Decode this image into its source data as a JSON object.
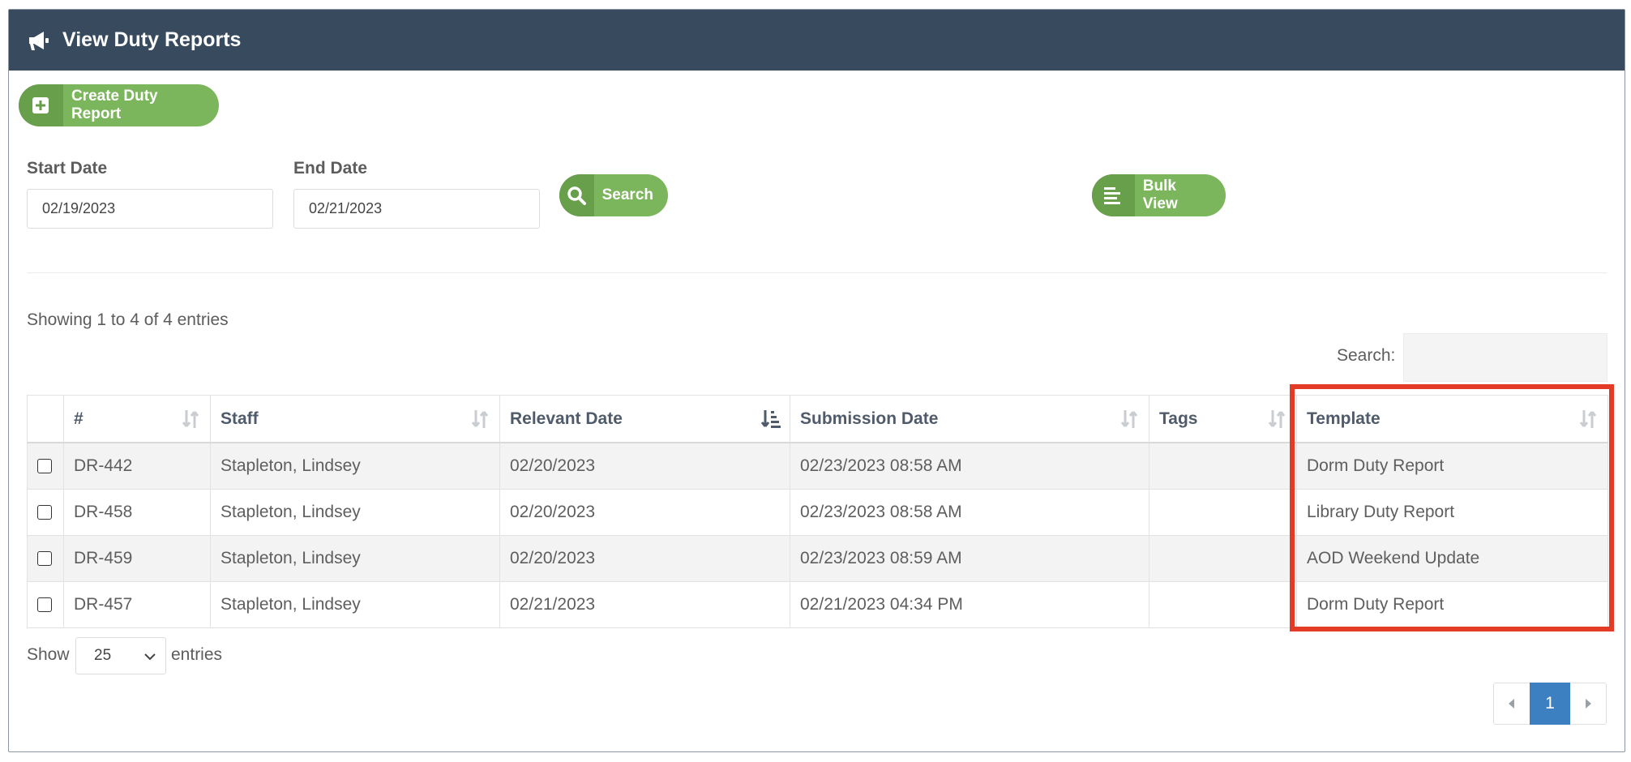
{
  "header": {
    "title": "View Duty Reports",
    "icon": "megaphone-icon"
  },
  "actions": {
    "create_label": "Create Duty Report",
    "search_label": "Search",
    "bulk_label": "Bulk View"
  },
  "filters": {
    "start_label": "Start Date",
    "start_value": "02/19/2023",
    "end_label": "End Date",
    "end_value": "02/21/2023"
  },
  "table_info": "Showing 1 to 4 of 4 entries",
  "table_search_label": "Search:",
  "columns": [
    "#",
    "Staff",
    "Relevant Date",
    "Submission Date",
    "Tags",
    "Template"
  ],
  "rows": [
    {
      "id": "DR-442",
      "staff": "Stapleton, Lindsey",
      "relevant": "02/20/2023",
      "submitted": "02/23/2023 08:58 AM",
      "tags": "",
      "template": "Dorm Duty Report"
    },
    {
      "id": "DR-458",
      "staff": "Stapleton, Lindsey",
      "relevant": "02/20/2023",
      "submitted": "02/23/2023 08:58 AM",
      "tags": "",
      "template": "Library Duty Report"
    },
    {
      "id": "DR-459",
      "staff": "Stapleton, Lindsey",
      "relevant": "02/20/2023",
      "submitted": "02/23/2023 08:59 AM",
      "tags": "",
      "template": "AOD Weekend Update"
    },
    {
      "id": "DR-457",
      "staff": "Stapleton, Lindsey",
      "relevant": "02/21/2023",
      "submitted": "02/21/2023 04:34 PM",
      "tags": "",
      "template": "Dorm Duty Report"
    }
  ],
  "length": {
    "show": "Show",
    "value": "25",
    "entries": "entries"
  },
  "pagination": {
    "current": "1"
  },
  "colors": {
    "header_bg": "#374a5e",
    "button_green": "#7cb65c",
    "highlight": "#e33b26",
    "page_active": "#3d80c2"
  }
}
